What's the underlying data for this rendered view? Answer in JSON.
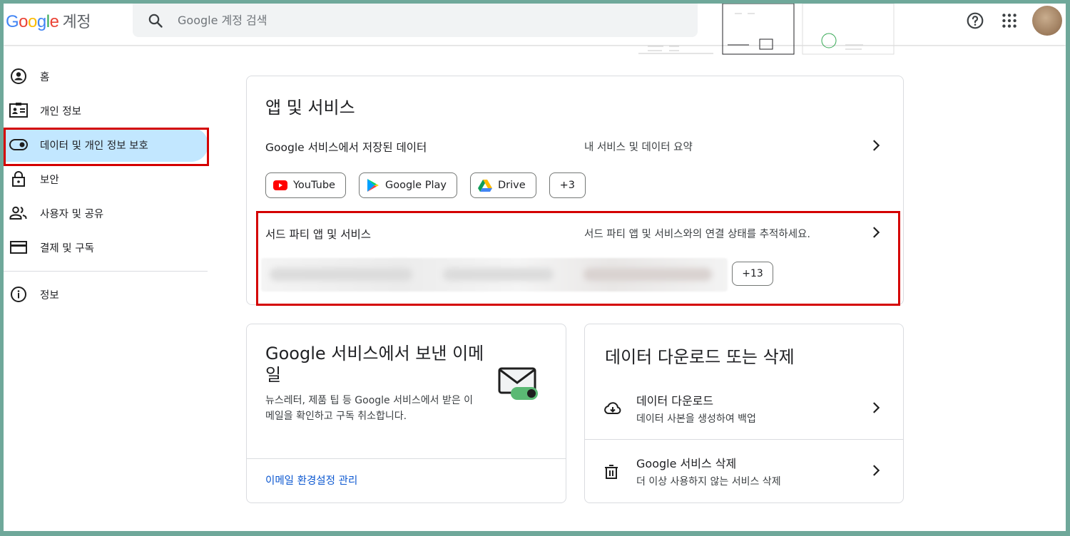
{
  "app": {
    "logo_parts": [
      "G",
      "o",
      "o",
      "g",
      "l",
      "e"
    ],
    "account_label": "계정"
  },
  "search": {
    "placeholder": "Google 계정 검색"
  },
  "sidebar": {
    "items": [
      {
        "label": "홈",
        "icon": "home-icon"
      },
      {
        "label": "개인 정보",
        "icon": "personal-info-icon"
      },
      {
        "label": "데이터 및 개인 정보 보호",
        "icon": "toggle-icon",
        "active": true
      },
      {
        "label": "보안",
        "icon": "lock-icon"
      },
      {
        "label": "사용자 및 공유",
        "icon": "people-icon"
      },
      {
        "label": "결제 및 구독",
        "icon": "credit-card-icon"
      }
    ],
    "info": {
      "label": "정보",
      "icon": "info-icon"
    }
  },
  "apps_card": {
    "title": "앱 및 서비스",
    "google_row": {
      "title": "Google 서비스에서 저장된 데이터",
      "desc": "내 서비스 및 데이터 요약"
    },
    "chips": [
      {
        "label": "YouTube",
        "icon": "youtube-icon"
      },
      {
        "label": "Google Play",
        "icon": "google-play-icon"
      },
      {
        "label": "Drive",
        "icon": "drive-icon"
      },
      {
        "label": "+3"
      }
    ],
    "third_party_row": {
      "title": "서드 파티 앱 및 서비스",
      "desc": "서드 파티 앱 및 서비스와의 연결 상태를 추적하세요."
    },
    "third_party_more": "+13"
  },
  "email_card": {
    "title": "Google 서비스에서 보낸 이메일",
    "body": "뉴스레터, 제품 팁 등 Google 서비스에서 받은 이메일을 확인하고 구독 취소합니다.",
    "link": "이메일 환경설정 관리"
  },
  "download_card": {
    "title": "데이터 다운로드 또는 삭제",
    "rows": [
      {
        "title": "데이터 다운로드",
        "desc": "데이터 사본을 생성하여 백업",
        "icon": "cloud-download-icon"
      },
      {
        "title": "Google 서비스 삭제",
        "desc": "더 이상 사용하지 않는 서비스 삭제",
        "icon": "trash-icon"
      }
    ]
  },
  "colors": {
    "accent": "#0b57d0",
    "active_bg": "#c2e7ff",
    "highlight": "#d40000",
    "frame": "#6fa89a"
  }
}
